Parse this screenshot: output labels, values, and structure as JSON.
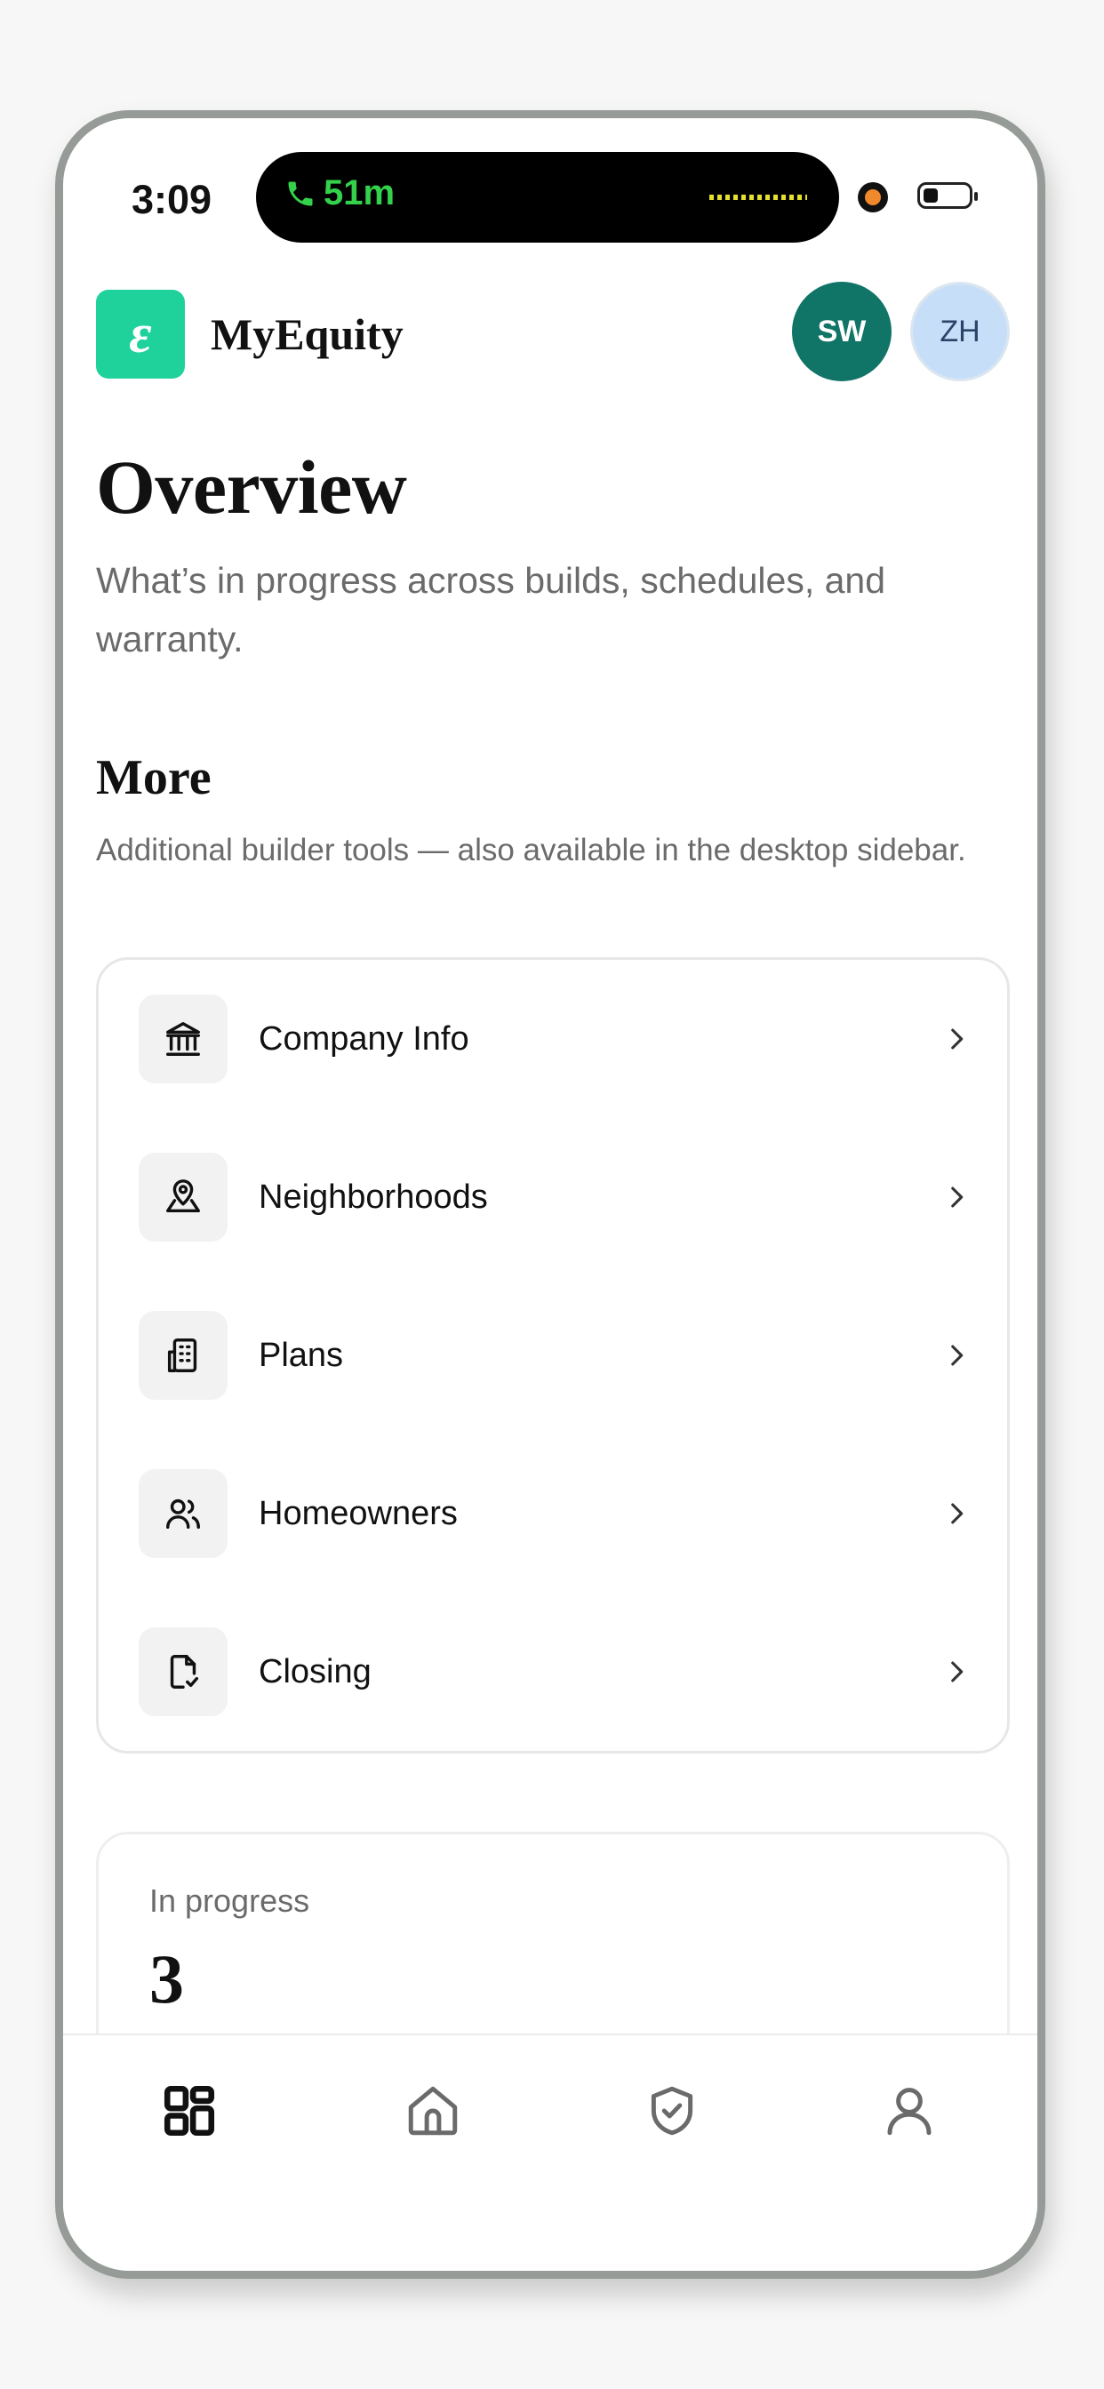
{
  "status_bar": {
    "time": "3:09",
    "call_duration": "51m",
    "call_icon": "phone-icon",
    "accent_call": "#34d14b"
  },
  "header": {
    "logo_letter": "ε",
    "brand": "MyEquity",
    "logo_color": "#1fd19a",
    "avatars": [
      {
        "initials": "SW",
        "color": "#107467"
      },
      {
        "initials": "ZH",
        "color": "#c7def9"
      }
    ]
  },
  "page": {
    "title": "Overview",
    "subtitle": "What’s in progress across builds, schedules, and warranty."
  },
  "more": {
    "title": "More",
    "subtitle": "Additional builder tools — also available in the desktop sidebar.",
    "items": [
      {
        "label": "Company Info",
        "icon": "bank-icon"
      },
      {
        "label": "Neighborhoods",
        "icon": "map-pin-icon"
      },
      {
        "label": "Plans",
        "icon": "building-icon"
      },
      {
        "label": "Homeowners",
        "icon": "users-icon"
      },
      {
        "label": "Closing",
        "icon": "file-check-icon"
      }
    ]
  },
  "stats": {
    "in_progress_label": "In progress",
    "in_progress_value": "3"
  },
  "tabbar": {
    "tabs": [
      {
        "icon": "dashboard-icon",
        "active": true
      },
      {
        "icon": "home-icon",
        "active": false
      },
      {
        "icon": "shield-check-icon",
        "active": false
      },
      {
        "icon": "user-icon",
        "active": false
      }
    ]
  }
}
